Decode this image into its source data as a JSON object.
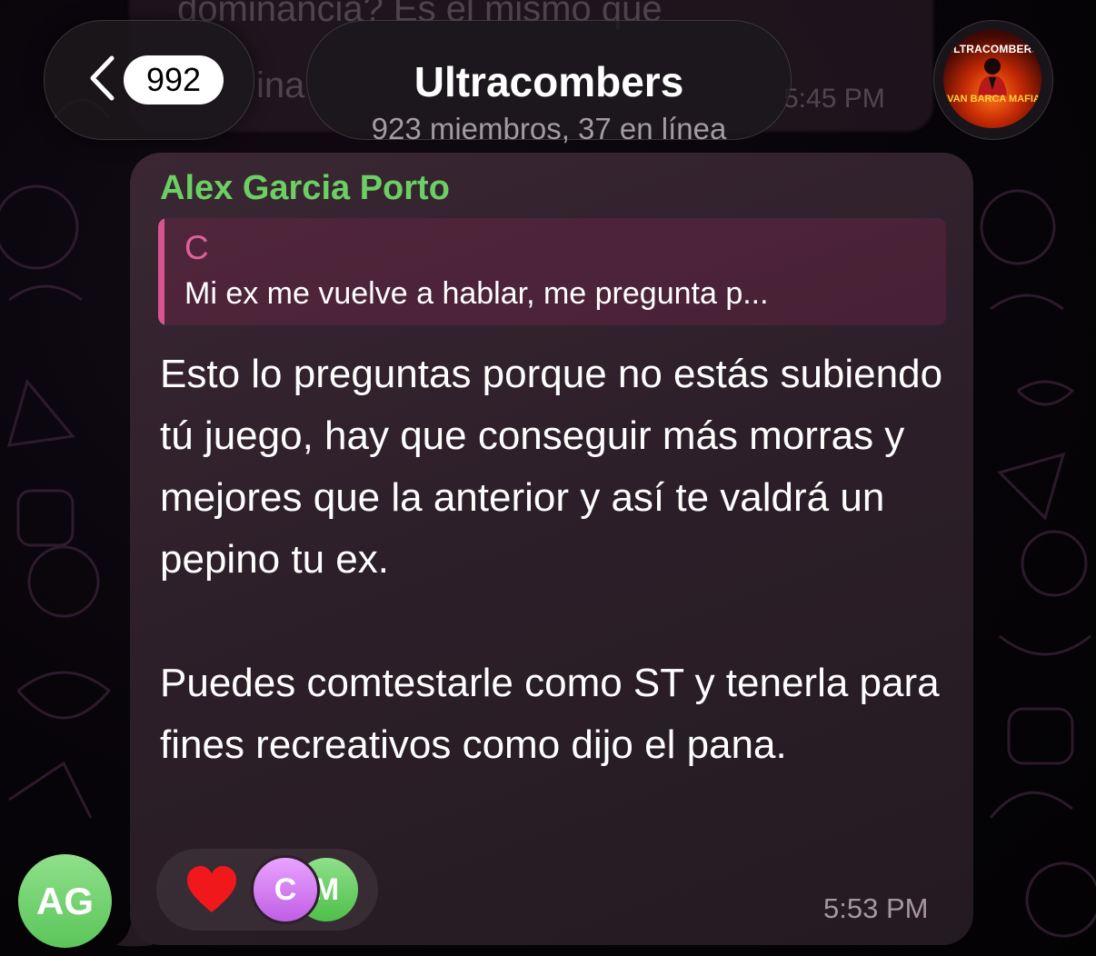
{
  "header": {
    "back_badge": "992",
    "chat_title": "Ultracombers",
    "chat_subtitle": "923 miembros, 37 en línea",
    "group_avatar_top_text": "ULTRACOMBERS",
    "group_avatar_bottom_text": "IVAN BARCA MAFIA"
  },
  "previous_message": {
    "line1": "dominancia? Es el mismo que",
    "line2": "ina",
    "time": "5:45 PM"
  },
  "message": {
    "sender": "Alex Garcia Porto",
    "sender_initials": "AG",
    "reply": {
      "author": "C",
      "text": "Mi ex me vuelve a hablar, me pregunta p..."
    },
    "paragraph1": "Esto lo preguntas porque no estás subiendo tú juego, hay que conseguir más morras y mejores que la anterior y así te valdrá un pepino tu ex.",
    "paragraph2": "Puedes comtestarle como ST y tenerla para fines recreativos como dijo el pana.",
    "time": "5:53 PM",
    "reactions": {
      "emoji": "heart-icon",
      "reactor_initials": [
        "C",
        "M"
      ]
    }
  },
  "colors": {
    "sender_name": "#6bcf63",
    "reply_accent": "#d9548f",
    "bubble": "#2d1f29"
  }
}
